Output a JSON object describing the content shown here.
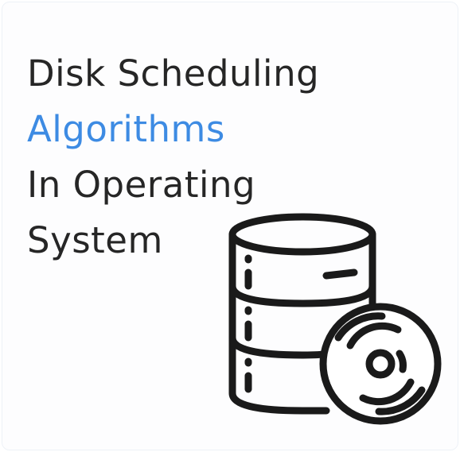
{
  "title": {
    "line1": "Disk Scheduling",
    "line2": "Algorithms",
    "line3": "In Operating",
    "line4": "System"
  },
  "icons": [
    "database-icon",
    "disc-icon"
  ],
  "colors": {
    "text": "#262626",
    "accent": "#3d8be3",
    "background": "#ffffff"
  }
}
